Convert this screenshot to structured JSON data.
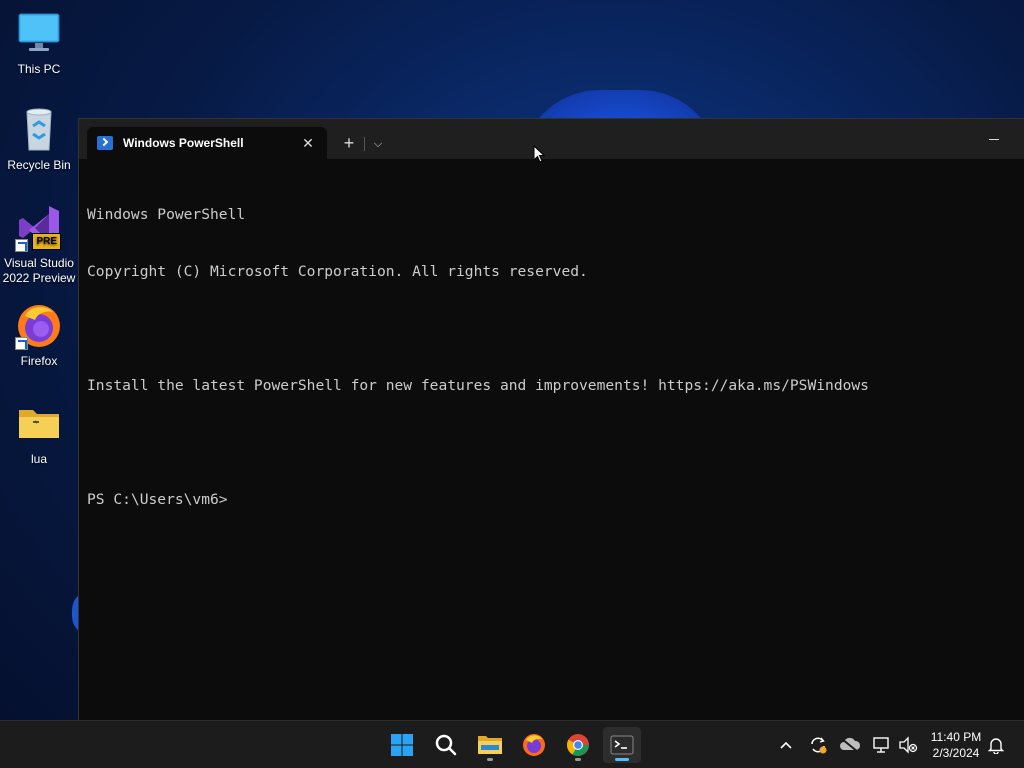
{
  "desktop": {
    "icons": [
      {
        "label": "This PC",
        "icon": "monitor-icon"
      },
      {
        "label": "Recycle Bin",
        "icon": "recycle-bin-icon"
      },
      {
        "label": "Visual Studio 2022 Preview",
        "icon": "visual-studio-icon",
        "badge": "PRE"
      },
      {
        "label": "Firefox",
        "icon": "firefox-icon"
      },
      {
        "label": "lua",
        "icon": "folder-icon"
      }
    ]
  },
  "terminal": {
    "tab_title": "Windows PowerShell",
    "tab_close": "✕",
    "new_tab": "+",
    "dropdown": "⌵",
    "lines": [
      "Windows PowerShell",
      "Copyright (C) Microsoft Corporation. All rights reserved.",
      "",
      "Install the latest PowerShell for new features and improvements! https://aka.ms/PSWindows",
      "",
      "PS C:\\Users\\vm6>"
    ]
  },
  "taskbar": {
    "apps": [
      {
        "name": "start-button",
        "icon": "windows-logo-icon",
        "active": false
      },
      {
        "name": "search-button",
        "icon": "search-icon",
        "active": false
      },
      {
        "name": "file-explorer",
        "icon": "folder-icon",
        "active": false,
        "running": true
      },
      {
        "name": "firefox",
        "icon": "firefox-icon",
        "active": false
      },
      {
        "name": "chrome",
        "icon": "chrome-icon",
        "active": false,
        "running": true
      },
      {
        "name": "terminal",
        "icon": "terminal-icon",
        "active": true
      }
    ],
    "tray": {
      "chevron": "^",
      "time": "11:40 PM",
      "date": "2/3/2024"
    }
  },
  "colors": {
    "accent": "#4cc2ff",
    "console_bg": "#0c0c0c",
    "console_text": "#cccccc",
    "taskbar_bg": "#1c1c1c"
  }
}
